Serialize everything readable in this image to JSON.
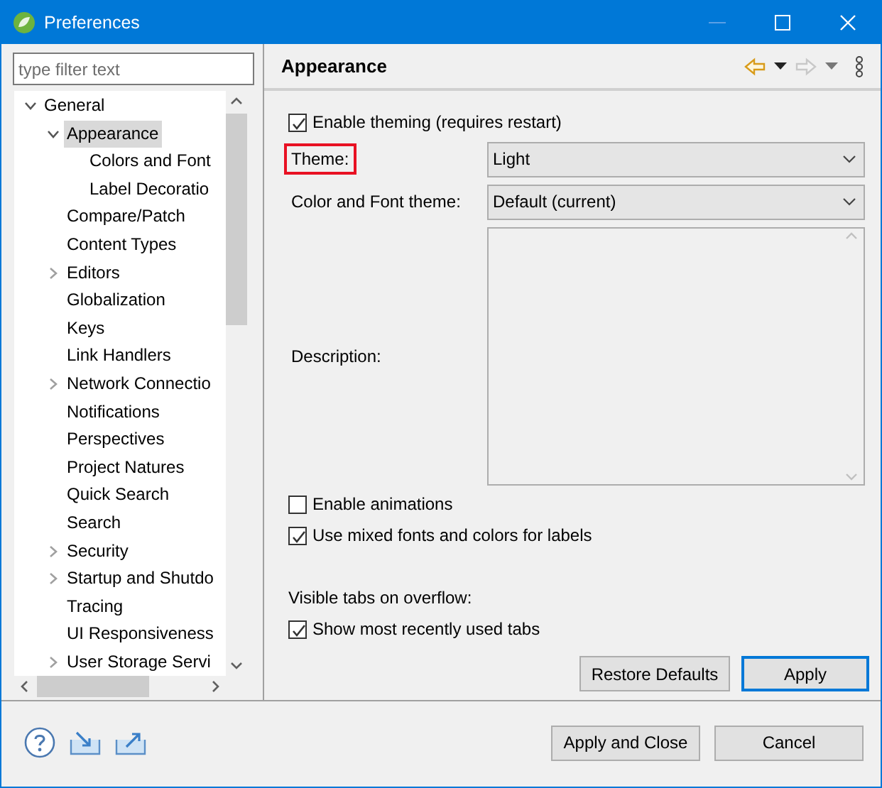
{
  "window": {
    "title": "Preferences"
  },
  "filter": {
    "placeholder": "type filter text"
  },
  "tree": [
    {
      "label": "General",
      "expanded": true,
      "selected": false,
      "children": [
        {
          "label": "Appearance",
          "expanded": true,
          "selected": true,
          "children": [
            {
              "label": "Colors and Font",
              "selected": false
            },
            {
              "label": "Label Decoratio",
              "selected": false
            }
          ]
        },
        {
          "label": "Compare/Patch",
          "selected": false
        },
        {
          "label": "Content Types",
          "selected": false
        },
        {
          "label": "Editors",
          "expanded": false,
          "selected": false
        },
        {
          "label": "Globalization",
          "selected": false
        },
        {
          "label": "Keys",
          "selected": false
        },
        {
          "label": "Link Handlers",
          "selected": false
        },
        {
          "label": "Network Connectio",
          "expanded": false,
          "selected": false
        },
        {
          "label": "Notifications",
          "selected": false
        },
        {
          "label": "Perspectives",
          "selected": false
        },
        {
          "label": "Project Natures",
          "selected": false
        },
        {
          "label": "Quick Search",
          "selected": false
        },
        {
          "label": "Search",
          "selected": false
        },
        {
          "label": "Security",
          "expanded": false,
          "selected": false
        },
        {
          "label": "Startup and Shutdo",
          "expanded": false,
          "selected": false
        },
        {
          "label": "Tracing",
          "selected": false
        },
        {
          "label": "UI Responsiveness",
          "selected": false
        },
        {
          "label": "User Storage Servi",
          "expanded": false,
          "selected": false
        }
      ]
    }
  ],
  "page": {
    "title": "Appearance",
    "back": {
      "disabled": false
    },
    "forward": {
      "disabled": true
    }
  },
  "settings": [
    {
      "kind": "checkbox",
      "label": "Enable theming (requires restart)",
      "checked": true
    },
    {
      "kind": "select",
      "label": "Theme:",
      "value": "Light",
      "highlighted": true
    },
    {
      "kind": "select",
      "label": "Color and Font theme:",
      "value": "Default (current)",
      "highlighted": false
    },
    {
      "kind": "textarea",
      "label": "Description:",
      "highlighted": false
    },
    {
      "kind": "checkbox",
      "label": "Enable animations",
      "checked": false
    },
    {
      "kind": "checkbox",
      "label": "Use mixed fonts and colors for labels",
      "checked": true
    },
    {
      "kind": "heading",
      "label": "Visible tabs on overflow:"
    },
    {
      "kind": "checkbox",
      "label": "Show most recently used tabs",
      "checked": true
    }
  ],
  "page_buttons": [
    {
      "label": "Restore Defaults",
      "focused": false
    },
    {
      "label": "Apply",
      "focused": true
    }
  ],
  "footer_buttons": [
    {
      "label": "Apply and Close",
      "focused": false
    },
    {
      "label": "Cancel",
      "focused": false
    }
  ]
}
